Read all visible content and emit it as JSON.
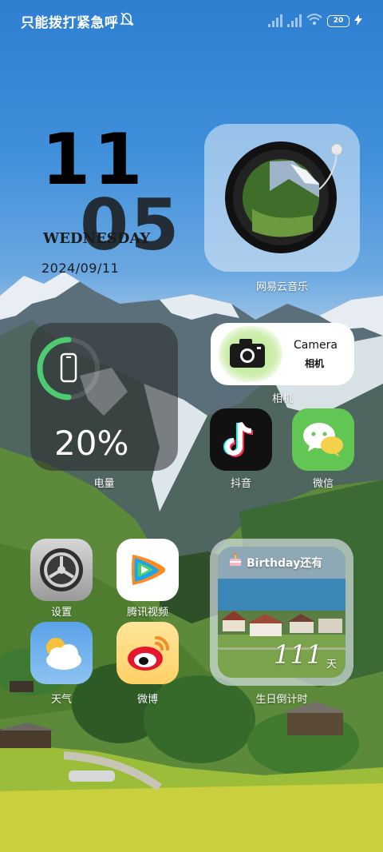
{
  "status_bar": {
    "carrier": "只能拨打紧急呼",
    "battery": "20"
  },
  "clock": {
    "hour": "11",
    "minute": "05",
    "weekday": "WEDNESDAY",
    "date": "2024/09/11"
  },
  "widgets": {
    "music": {
      "label": "网易云音乐"
    },
    "battery": {
      "percent_text": "20%",
      "level": 0.2,
      "label": "电量"
    },
    "camera": {
      "title": "Camera",
      "subtitle": "相机",
      "label": "相机"
    },
    "birthday": {
      "title": "Birthday还有",
      "count": "111",
      "unit": "天",
      "label": "生日倒计时"
    }
  },
  "apps": [
    {
      "label": "抖音",
      "icon": "tiktok-icon"
    },
    {
      "label": "微信",
      "icon": "wechat-icon"
    },
    {
      "label": "设置",
      "icon": "settings-icon"
    },
    {
      "label": "腾讯视频",
      "icon": "tencent-video-icon"
    },
    {
      "label": "天气",
      "icon": "weather-icon"
    },
    {
      "label": "微博",
      "icon": "weibo-icon"
    }
  ],
  "colors": {
    "battery_ring": "#4ecb71",
    "wechat_green": "#62c654",
    "camera_glow": "#b7e48f"
  }
}
